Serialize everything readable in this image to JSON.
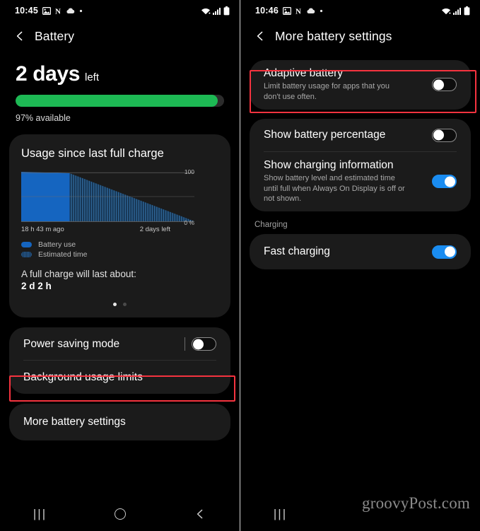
{
  "left_screen": {
    "status_bar": {
      "time": "10:45",
      "icons_left": [
        "image-icon",
        "nfc-icon",
        "cloud-icon",
        "dot-icon"
      ],
      "icons_right": [
        "wifi-icon",
        "signal-icon",
        "battery-icon"
      ]
    },
    "app_bar": {
      "back": "back-chevron",
      "title": "Battery"
    },
    "summary": {
      "days": "2 days",
      "left_suffix": "left",
      "available": "97% available",
      "percent": 97
    },
    "usage_card": {
      "title": "Usage since last full charge",
      "chart_xlabel_left": "18 h 43 m ago",
      "chart_xlabel_right": "2 days left",
      "axis_top": "100",
      "axis_bottom": "0 %",
      "legend": [
        {
          "label": "Battery use",
          "style": "solid",
          "color": "#1565c0"
        },
        {
          "label": "Estimated time",
          "style": "hatch",
          "color": "#2a5f96"
        }
      ],
      "full_charge_label": "A full charge will last about:",
      "full_charge_value": "2 d 2 h",
      "page_dots": 2,
      "active_dot": 0
    },
    "rows": [
      {
        "label": "Power saving mode",
        "toggle": "off",
        "highlighted": true,
        "has_divider": true
      },
      {
        "label": "Background usage limits",
        "toggle": null,
        "highlighted": false,
        "has_divider": false
      }
    ],
    "more_row": {
      "label": "More battery settings"
    },
    "nav": {
      "recents": "|||",
      "home": "home-circle",
      "back": "back-chevron"
    }
  },
  "right_screen": {
    "status_bar": {
      "time": "10:46",
      "icons_left": [
        "image-icon",
        "nfc-icon",
        "cloud-icon",
        "dot-icon"
      ],
      "icons_right": [
        "wifi-icon",
        "signal-icon",
        "battery-icon"
      ]
    },
    "app_bar": {
      "back": "back-chevron",
      "title": "More battery settings"
    },
    "rows": [
      {
        "label": "Adaptive battery",
        "sub": "Limit battery usage for apps that you don't use often.",
        "toggle": "off",
        "highlighted": true
      },
      {
        "label": "Show battery percentage",
        "sub": "",
        "toggle": "off",
        "highlighted": false
      },
      {
        "label": "Show charging information",
        "sub": "Show battery level and estimated time until full when Always On Display is off or not shown.",
        "toggle": "on",
        "highlighted": false
      }
    ],
    "section_charging": "Charging",
    "fast_charging": {
      "label": "Fast charging",
      "toggle": "on"
    },
    "nav": {
      "recents": "|||"
    },
    "watermark": "groovyPost.com"
  },
  "chart_data": {
    "type": "area",
    "title": "Usage since last full charge",
    "xlabel": "",
    "ylabel": "",
    "ylim": [
      0,
      100
    ],
    "yticks": [
      0,
      100
    ],
    "ytick_labels": [
      "0 %",
      "100"
    ],
    "x_tick_labels": [
      "18 h 43 m ago",
      "2 days left"
    ],
    "grid": true,
    "legend_position": "below",
    "series": [
      {
        "name": "Battery use",
        "style": "solid",
        "color": "#1565c0",
        "x": [
          0,
          28
        ],
        "values": [
          100,
          97
        ]
      },
      {
        "name": "Estimated time",
        "style": "hatched",
        "color": "#2a5f96",
        "x": [
          28,
          100
        ],
        "values": [
          97,
          0
        ]
      }
    ]
  },
  "colors": {
    "accent_green": "#1db954",
    "accent_blue": "#1a8cf0",
    "chart_blue": "#1565c0",
    "highlight_red": "#f5333f",
    "card_bg": "#1b1b1b",
    "page_bg": "#000000"
  }
}
